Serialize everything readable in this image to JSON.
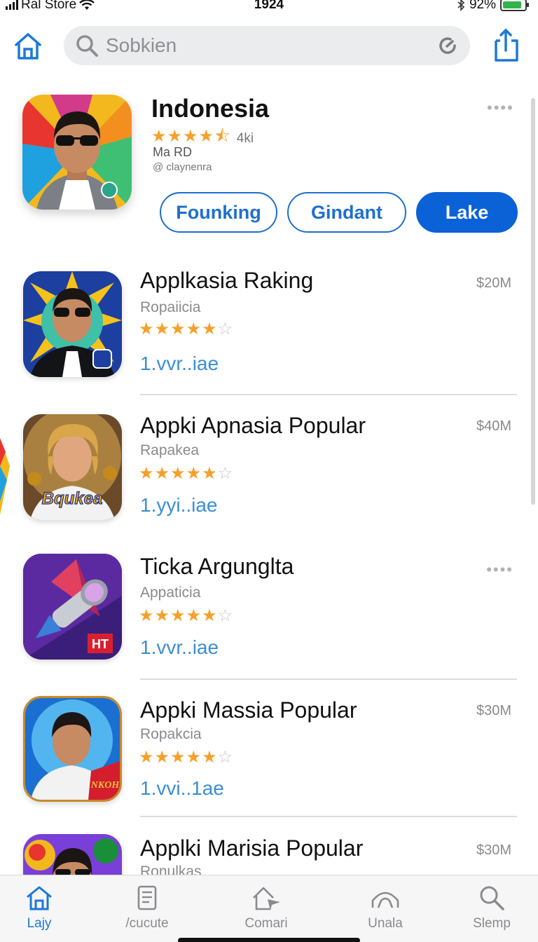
{
  "status_bar": {
    "carrier": "Ral Store",
    "time": "1924",
    "battery": "92%"
  },
  "search": {
    "placeholder": "Sobkien"
  },
  "featured": {
    "title": "Indonesia",
    "rating_count": "4ki",
    "rating_value": 4.5,
    "developer": "Ma RD",
    "handle": "@ claynenra",
    "buttons": [
      "Founking",
      "Gindant",
      "Lake"
    ]
  },
  "apps": [
    {
      "title": "Applkasia Raking",
      "subtitle": "Ropaiicia",
      "version": "1.vvr..iae",
      "price": "$20M"
    },
    {
      "title": "Appki Apnasia Popular",
      "subtitle": "Rapakea",
      "version": "1.yyi..iae",
      "price": "$40M",
      "icon_text": "Bqukea"
    },
    {
      "title": "Ticka Argunglta",
      "subtitle": "Appaticia",
      "version": "1.vvr..iae",
      "price": "",
      "icon_text": "HT"
    },
    {
      "title": "Appki Massia Popular",
      "subtitle": "Ropakcia",
      "version": "1.vvi..1ae",
      "price": "$30M",
      "icon_text": "NKOH"
    },
    {
      "title": "Applki Marisia Popular",
      "subtitle": "Ronulkas",
      "version": "",
      "price": "$30M"
    }
  ],
  "tabs": [
    {
      "label": "Lajy",
      "icon": "home-icon",
      "active": true
    },
    {
      "label": "/cucute",
      "icon": "document-icon",
      "active": false
    },
    {
      "label": "Comari",
      "icon": "house-plane-icon",
      "active": false
    },
    {
      "label": "Unala",
      "icon": "dome-icon",
      "active": false
    },
    {
      "label": "Slemp",
      "icon": "search-icon",
      "active": false
    }
  ],
  "colors": {
    "accent": "#0b62d6",
    "star": "#f6a02a",
    "version_link": "#3b8ed6"
  }
}
